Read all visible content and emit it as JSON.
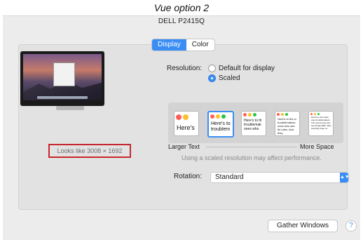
{
  "caption": "Vue option 2",
  "window": {
    "title": "DELL P2415Q"
  },
  "tabs": [
    {
      "label": "Display",
      "active": true
    },
    {
      "label": "Color",
      "active": false
    }
  ],
  "display": {
    "looks_like": "Looks like 3008 × 1692"
  },
  "resolution": {
    "label": "Resolution:",
    "options": [
      {
        "label": "Default for display",
        "selected": false
      },
      {
        "label": "Scaled",
        "selected": true
      }
    ],
    "thumbnails": [
      {
        "text": "Here's",
        "selected": false
      },
      {
        "text": "Here's to troublem",
        "selected": true
      },
      {
        "text": "Here's to th troublemak ones who",
        "selected": false
      },
      {
        "text": "Here's to the cr troublemakers. ones who see thi rules. And they",
        "selected": false
      },
      {
        "text": "Here's to the crazy ones troublemakers. The round ones who see things differ rules. And they have no",
        "selected": false
      }
    ],
    "scale_left": "Larger Text",
    "scale_right": "More Space",
    "note": "Using a scaled resolution may affect performance."
  },
  "rotation": {
    "label": "Rotation:",
    "value": "Standard"
  },
  "buttons": {
    "gather": "Gather Windows",
    "help": "?"
  },
  "colors": {
    "accent": "#3a8df5",
    "highlight_box": "#c6262e"
  }
}
